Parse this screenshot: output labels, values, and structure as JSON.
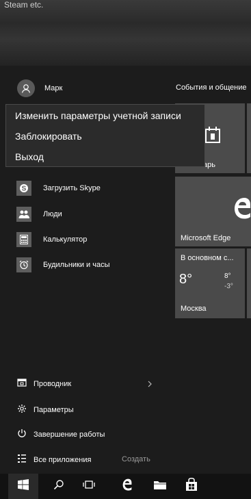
{
  "desktop": {
    "title": "Steam etc."
  },
  "user": {
    "name": "Марк"
  },
  "tiles_group": {
    "title": "События и общение"
  },
  "context_menu": {
    "items": [
      "Изменить параметры учетной записи",
      "Заблокировать",
      "Выход"
    ]
  },
  "apps": [
    {
      "label": "Загрузить Skype",
      "icon": "skype-icon"
    },
    {
      "label": "Люди",
      "icon": "people-icon"
    },
    {
      "label": "Калькулятор",
      "icon": "calculator-icon"
    },
    {
      "label": "Будильники и часы",
      "icon": "alarm-clock-icon"
    }
  ],
  "tiles": {
    "calendar": {
      "label": "арь"
    },
    "edge": {
      "label": "Microsoft Edge"
    },
    "weather": {
      "summary": "В основном с...",
      "temp": "8°",
      "high": "8°",
      "low": "-3°",
      "city": "Москва"
    }
  },
  "nav": {
    "explorer": "Проводник",
    "settings": "Параметры",
    "power": "Завершение работы",
    "all_apps": "Все приложения",
    "create": "Создать"
  }
}
